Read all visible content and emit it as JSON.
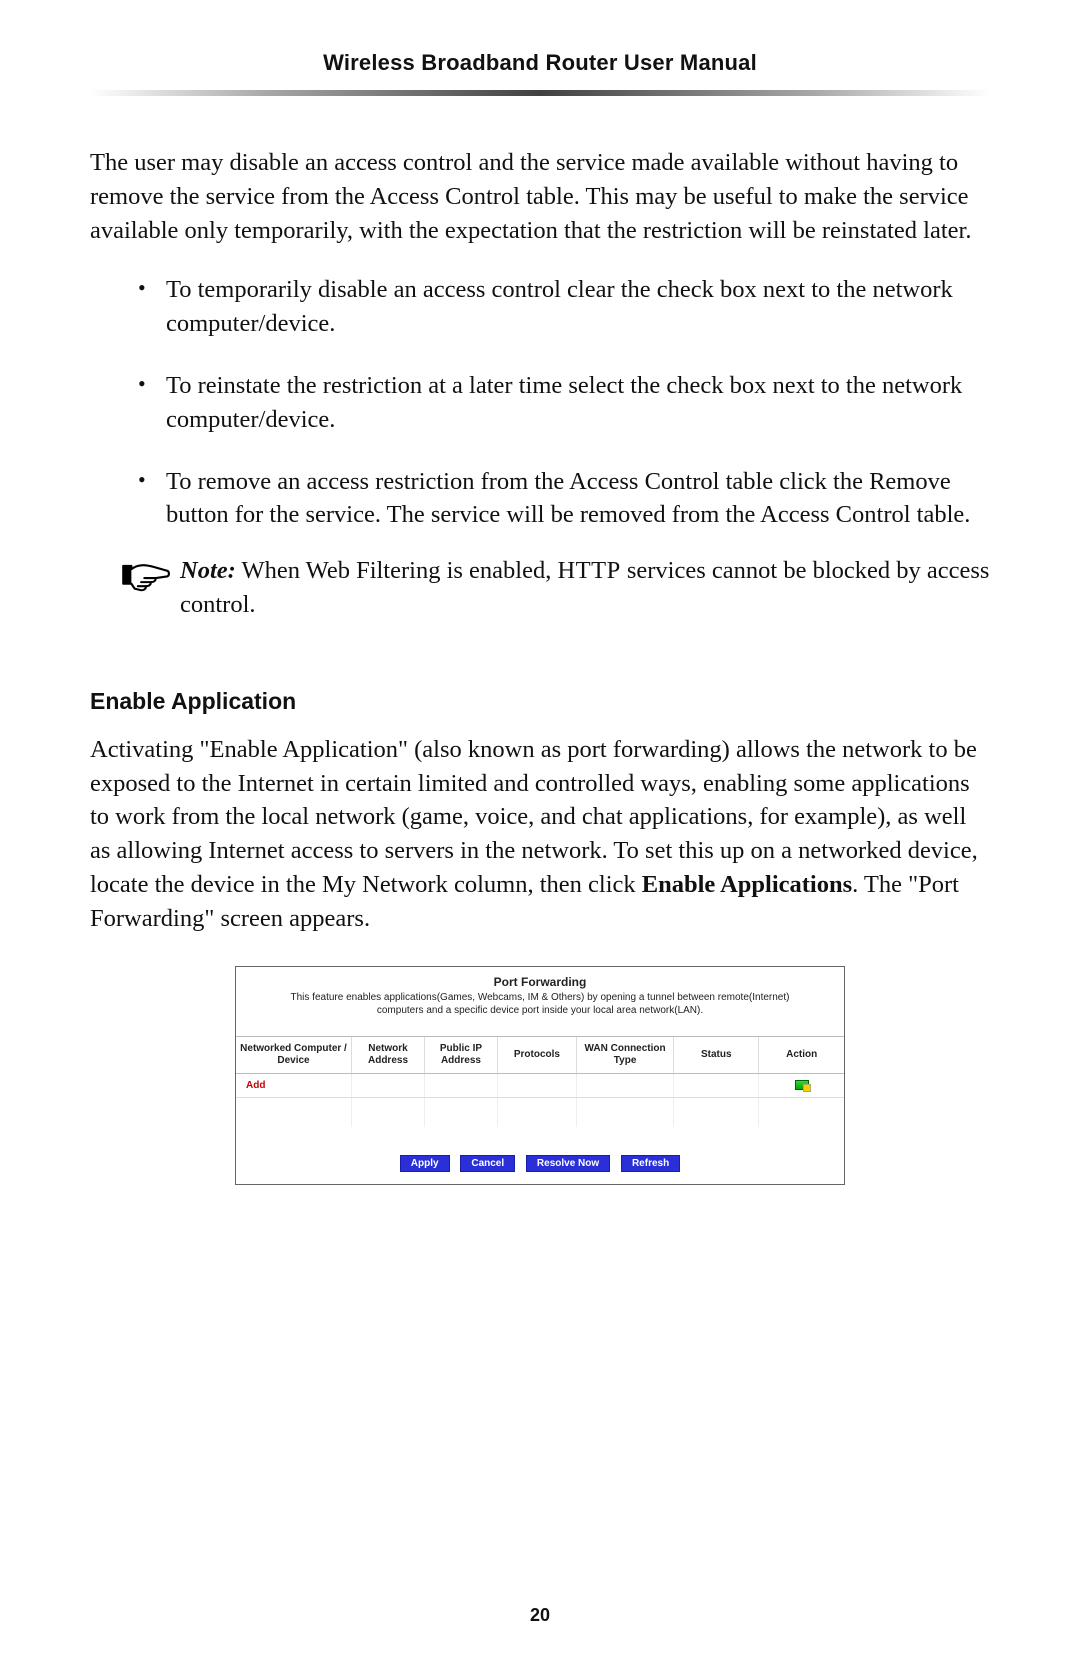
{
  "header": {
    "title": "Wireless Broadband Router User Manual"
  },
  "intro": "The user may disable an access control and the service made available without having to remove the service from the Access Control table. This may be useful to make the service available only temporarily, with the expectation that the restriction will be reinstated later.",
  "bullets": [
    "To temporarily disable an access control clear the check box next to the network computer/device.",
    "To reinstate the restriction at a later time select the check box next to the network computer/device.",
    "To remove an access restriction from the Access Control table click the Remove button for the service. The service will be removed from the Access Control table."
  ],
  "note": {
    "label": "Note:",
    "before_sc": " When Web Filtering is enabled, ",
    "sc_word": "HTTP",
    "after_sc": " services cannot be blocked by access control."
  },
  "section": {
    "heading": "Enable Application",
    "body_pre": "Activating \"Enable Application\" (also known as port forwarding) allows the network to be exposed to the Internet in certain limited and controlled ways, enabling some applications to work from the local network (game, voice, and chat applications, for example), as well as allowing Internet access to servers in the network. To set this up on a networked device, locate the device in the My Network column, then click ",
    "body_bold": "Enable Applications",
    "body_post": ". The \"Port Forwarding\" screen appears."
  },
  "screenshot": {
    "title": "Port Forwarding",
    "subtitle": "This feature enables applications(Games, Webcams, IM & Others) by opening a tunnel between remote(Internet) computers and a specific device port inside your local area network(LAN).",
    "columns": [
      "Networked Computer / Device",
      "Network Address",
      "Public IP Address",
      "Protocols",
      "WAN Connection Type",
      "Status",
      "Action"
    ],
    "add_label": "Add",
    "buttons": [
      "Apply",
      "Cancel",
      "Resolve Now",
      "Refresh"
    ]
  },
  "page_number": "20"
}
